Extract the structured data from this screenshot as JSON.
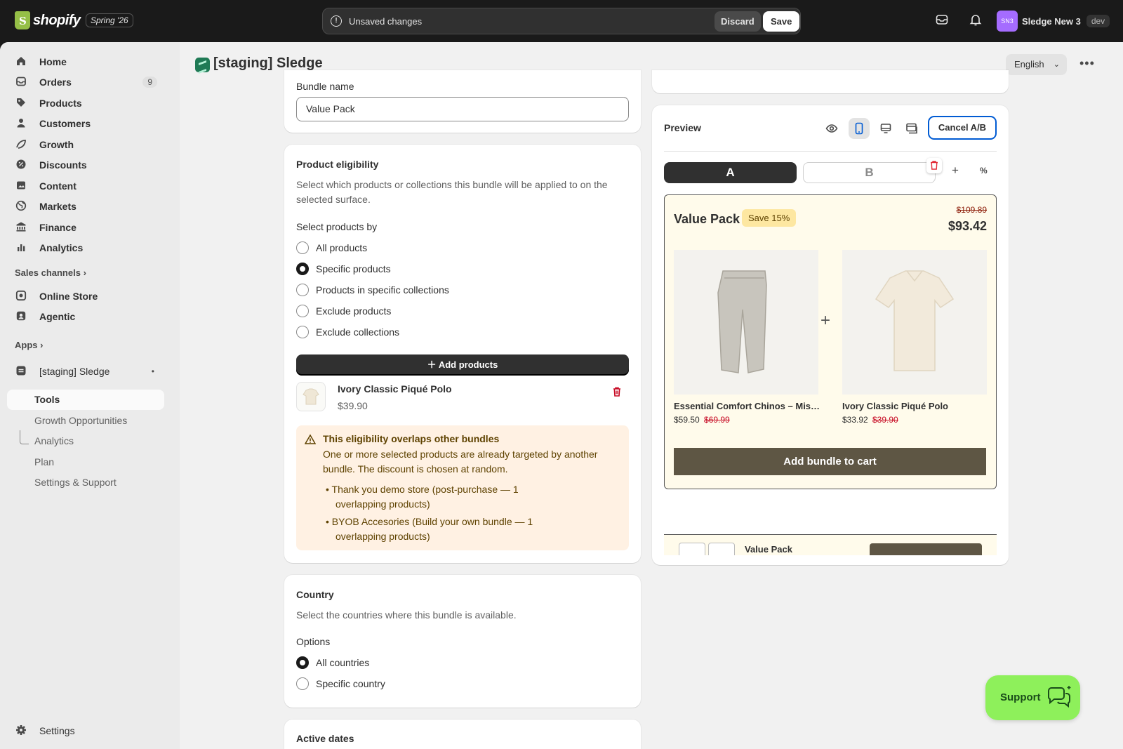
{
  "topbar": {
    "logo_text": "shopify",
    "edition": "Spring '26",
    "unsaved_label": "Unsaved changes",
    "discard_label": "Discard",
    "save_label": "Save",
    "store_initials": "SN3",
    "store_name": "Sledge New 3",
    "env_badge": "dev"
  },
  "sidebar": {
    "items": [
      {
        "label": "Home",
        "icon": "home-icon"
      },
      {
        "label": "Orders",
        "icon": "orders-icon",
        "count": "9"
      },
      {
        "label": "Products",
        "icon": "tag-icon"
      },
      {
        "label": "Customers",
        "icon": "person-icon"
      },
      {
        "label": "Growth",
        "icon": "growth-icon"
      },
      {
        "label": "Discounts",
        "icon": "discount-icon"
      },
      {
        "label": "Content",
        "icon": "content-icon"
      },
      {
        "label": "Markets",
        "icon": "globe-icon"
      },
      {
        "label": "Finance",
        "icon": "bank-icon"
      },
      {
        "label": "Analytics",
        "icon": "chart-icon"
      }
    ],
    "sales_channels_label": "Sales channels",
    "channels": [
      {
        "label": "Online Store",
        "icon": "store-icon"
      },
      {
        "label": "Agentic",
        "icon": "agentic-icon"
      }
    ],
    "apps_label": "Apps",
    "app_name": "[staging] Sledge",
    "app_sub": [
      "Tools",
      "Growth Opportunities",
      "Analytics",
      "Plan",
      "Settings & Support"
    ],
    "settings_label": "Settings"
  },
  "header": {
    "title": "[staging] Sledge",
    "language": "English"
  },
  "bundle_card": {
    "name_label": "Bundle name",
    "name_value": "Value Pack"
  },
  "eligibility": {
    "title": "Product eligibility",
    "description": "Select which products or collections this bundle will be applied to on the selected surface.",
    "select_by_label": "Select products by",
    "options": [
      "All products",
      "Specific products",
      "Products in specific collections",
      "Exclude products",
      "Exclude collections"
    ],
    "selected": "Specific products",
    "add_button": "Add products",
    "product": {
      "name": "Ivory Classic Piqué Polo",
      "price": "$39.90"
    },
    "warning": {
      "title": "This eligibility overlaps other bundles",
      "body": "One or more selected products are already targeted by another bundle. The discount is chosen at random.",
      "items": [
        {
          "link": "Thank you demo store",
          "note": "(post-purchase — 1",
          "note2": "overlapping products)"
        },
        {
          "link": "BYOB Accesories",
          "note": "(Build your own bundle — 1",
          "note2": "overlapping products)"
        }
      ]
    }
  },
  "country": {
    "title": "Country",
    "description": "Select the countries where this bundle is available.",
    "options_label": "Options",
    "options": [
      "All countries",
      "Specific country"
    ],
    "selected": "All countries"
  },
  "active_dates": {
    "title": "Active dates"
  },
  "preview": {
    "title": "Preview",
    "cancel_ab": "Cancel A/B",
    "variant_a": "A",
    "variant_b": "B",
    "bundle_title": "Value Pack",
    "save_badge": "Save 15%",
    "compare_price": "$109.89",
    "price": "$93.42",
    "products": [
      {
        "name": "Essential Comfort Chinos – Mis…",
        "price": "$59.50",
        "compare": "$69.99"
      },
      {
        "name": "Ivory Classic Piqué Polo",
        "price": "$33.92",
        "compare": "$39.90"
      }
    ],
    "cta": "Add bundle to cart",
    "peek_title": "Value Pack"
  },
  "support": {
    "label": "Support"
  },
  "colors": {
    "accent_green": "#8ef05b",
    "warning_bg": "#fff1e3",
    "highlight_blue": "#005bd3",
    "bundle_button": "#5e5644"
  }
}
